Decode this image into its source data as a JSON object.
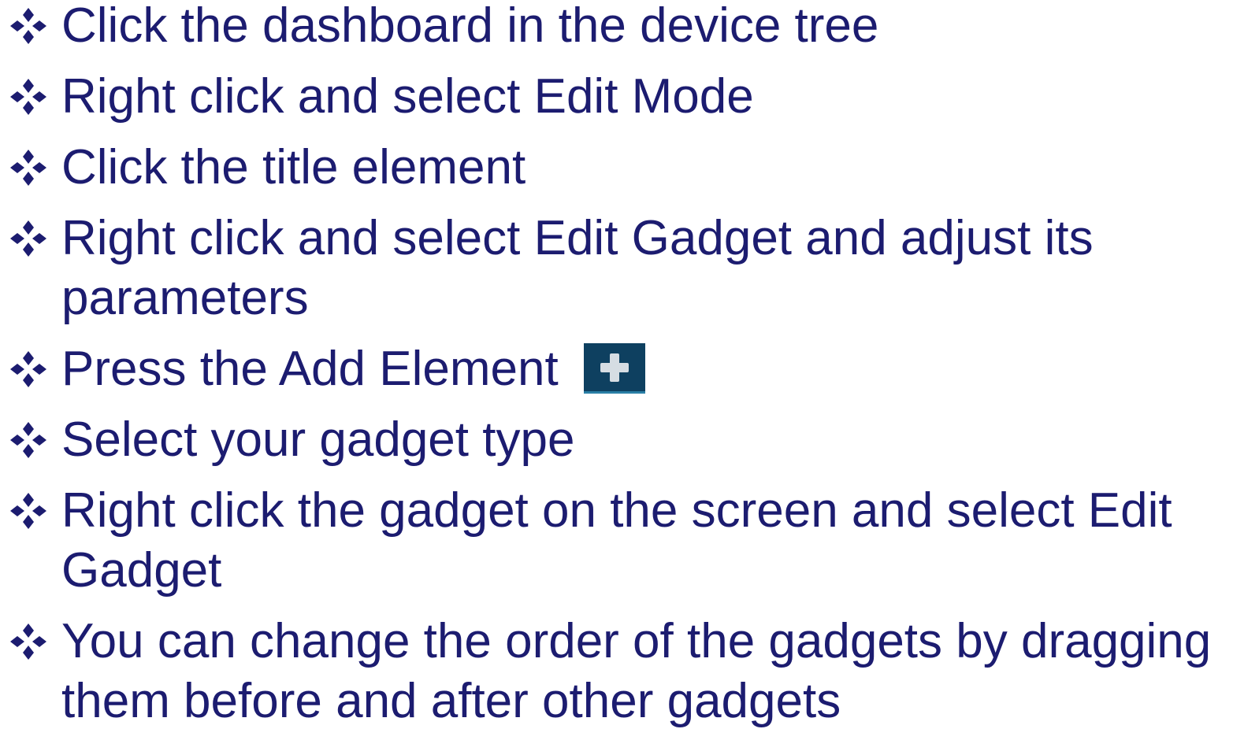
{
  "slide": {
    "text_color": "#1c1c70",
    "bullet_icon": "four-diamond-bullet-icon",
    "items": [
      {
        "lines": [
          "Click the dashboard in the device tree"
        ]
      },
      {
        "lines": [
          "Right click and select Edit Mode"
        ]
      },
      {
        "lines": [
          "Click the title element"
        ]
      },
      {
        "lines": [
          "Right click and select Edit Gadget and adjust its",
          "parameters"
        ]
      },
      {
        "lines": [
          "Press the Add Element"
        ]
      },
      {
        "lines": [
          "Select your gadget type"
        ]
      },
      {
        "lines": [
          "Right click the gadget on the screen and select Edit",
          "Gadget"
        ]
      },
      {
        "lines": [
          "You can change the order of the gadgets by dragging",
          "them before and after other gadgets"
        ]
      }
    ],
    "add_element_button": {
      "icon": "plus-icon",
      "background": "#0e4060"
    }
  }
}
